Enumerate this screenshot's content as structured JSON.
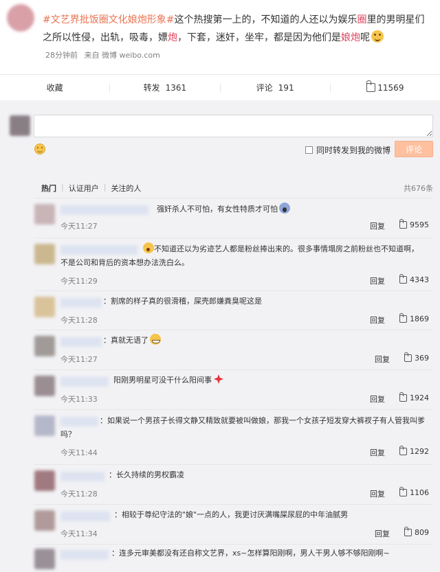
{
  "post": {
    "topic": "#文艺界批饭圈文化娘炮形象#",
    "text_a": "这个热搜第一上的，不知道的人还以为娱乐",
    "hl_1": "圈",
    "text_b": "里的男明星们之所以性侵，出轨，吸毒，嫖",
    "hl_2": "炮",
    "text_c": "，下套，迷奸，坐牢，都是因为他们是",
    "hl_3": "娘炮",
    "text_d": "呢",
    "emoji": "smirk-face-icon",
    "time": "28分钟前",
    "source": "来自 微博 weibo.com"
  },
  "actions": {
    "collect": "收藏",
    "repost_label": "转发",
    "repost_count": "1361",
    "comment_label": "评论",
    "comment_count": "191",
    "like_count": "11569"
  },
  "compose": {
    "forward_label": "同时转发到我的微博",
    "submit_label": "评论"
  },
  "tabs": {
    "hot": "热门",
    "verified": "认证用户",
    "following": "关注的人",
    "total": "共676条"
  },
  "comments": [
    {
      "text": "强奸杀人不可怕，有女性特质才可怕",
      "emoji": "scream-face-icon",
      "time": "今天11:27",
      "reply": "回复",
      "likes": "9595"
    },
    {
      "text": "不知道还以为劣迹艺人都是粉丝捧出来的。很多事情塌房之前粉丝也不知道啊，不是公司和背后的资本想办法洗白么。",
      "emoji": "shocked-face-icon",
      "time": "今天11:29",
      "reply": "回复",
      "likes": "4343"
    },
    {
      "text": "割席的样子真的很滑稽，屎壳郎嫌粪臭呢这是",
      "time": "今天11:28",
      "reply": "回复",
      "likes": "1869"
    },
    {
      "text": "真就无语了",
      "emoji": "grin-sweat-face-icon",
      "time": "今天11:27",
      "reply": "回复",
      "likes": "369"
    },
    {
      "text": "阳刚男明星可没干什么阳间事",
      "emoji": "anger-symbol-icon",
      "time": "今天11:33",
      "reply": "回复",
      "likes": "1924"
    },
    {
      "text": "如果说一个男孩子长得文静又精致就要被叫做娘，那我一个女孩子短发穿大裤衩子有人管我叫爹吗？",
      "time": "今天11:44",
      "reply": "回复",
      "likes": "1292"
    },
    {
      "text": "长久持续的男权霸凌",
      "time": "今天11:28",
      "reply": "回复",
      "likes": "1106"
    },
    {
      "text": "相较于尊纪守法的\"娘\"一点的人，我更讨厌满嘴屎尿屁的中年油腻男",
      "time": "今天11:34",
      "reply": "回复",
      "likes": "809"
    },
    {
      "text": "连多元审美都没有还自称文艺界，xs~怎样算阳刚啊，男人干男人够不够阳刚啊~"
    }
  ]
}
